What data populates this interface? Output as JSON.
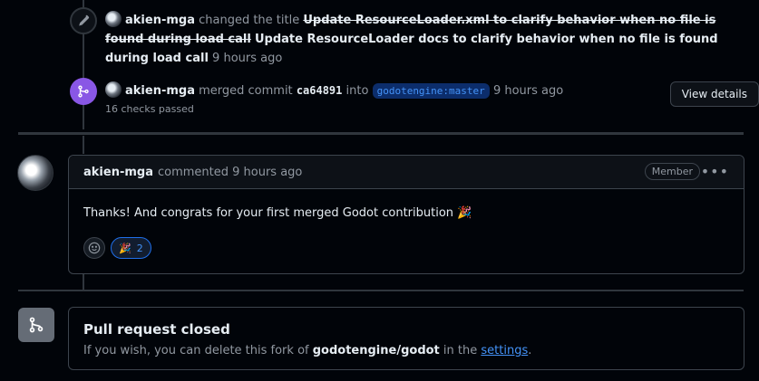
{
  "events": {
    "rename": {
      "author": "akien-mga",
      "action": "changed the title",
      "old_title": "Update ResourceLoader.xml to clarify behavior when no file is found during load call",
      "new_title": "Update ResourceLoader docs to clarify behavior when no file is found during load call",
      "time": "9 hours ago"
    },
    "merge": {
      "author": "akien-mga",
      "action": "merged commit",
      "sha": "ca64891",
      "into": "into",
      "branch": "godotengine:master",
      "time": "9 hours ago",
      "checks": "16 checks passed",
      "view_details": "View details"
    }
  },
  "comment": {
    "author": "akien-mga",
    "action": "commented",
    "time": "9 hours ago",
    "role": "Member",
    "body": "Thanks! And congrats for your first merged Godot contribution 🎉",
    "reaction_count": "2",
    "reaction_icon": "tada-icon"
  },
  "closed": {
    "title": "Pull request closed",
    "text_before": "If you wish, you can delete this fork of",
    "repo": "godotengine/godot",
    "text_mid": "in the",
    "link": "settings",
    "text_end": "."
  },
  "colors": {
    "merged": "#8957e5",
    "link": "#4493f8",
    "background": "#010409"
  }
}
